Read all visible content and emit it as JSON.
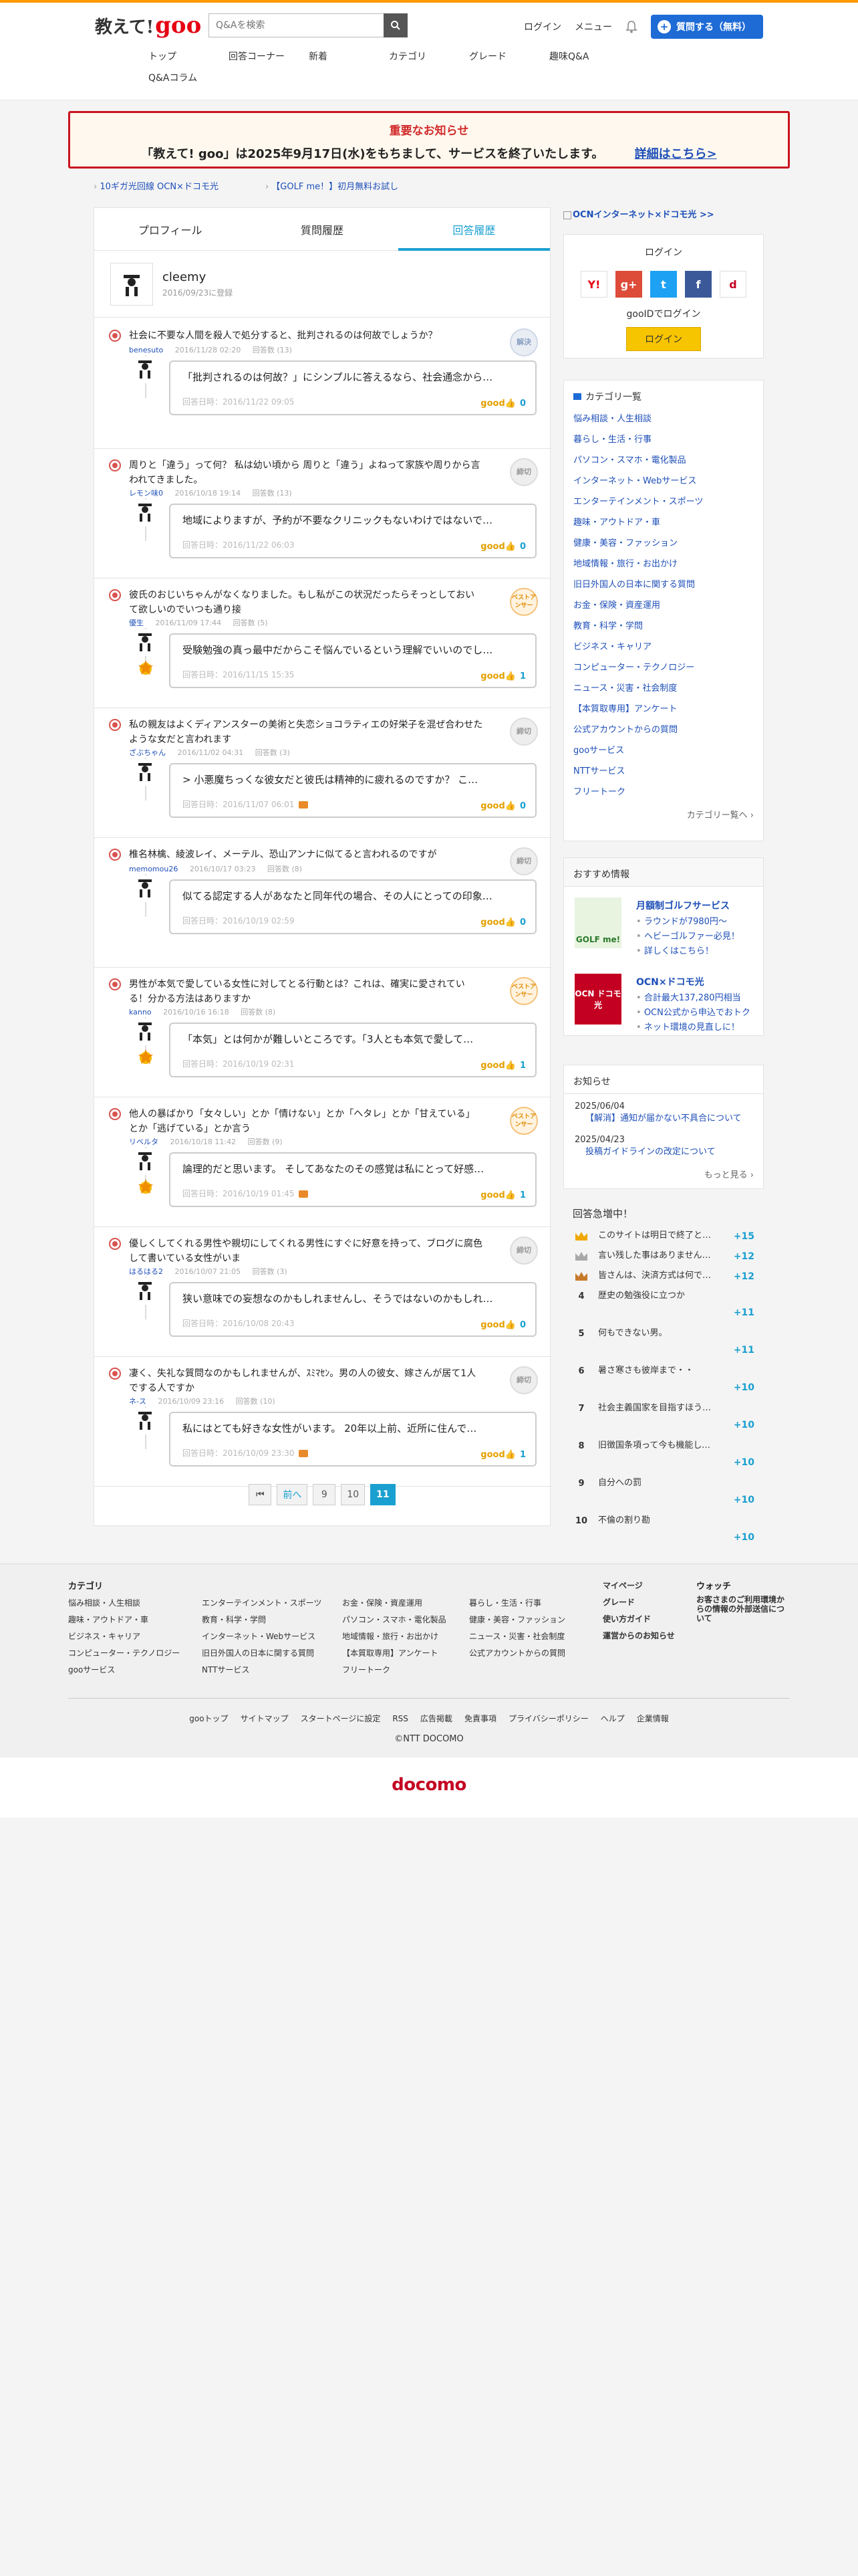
{
  "header": {
    "logo_prefix": "教えて!",
    "logo_goo": "goo",
    "search_placeholder": "Q&Aを検索",
    "login": "ログイン",
    "menu": "メニュー",
    "ask_button": "質問する（無料）",
    "nav": [
      "トップ",
      "回答コーナー",
      "新着",
      "カテゴリ",
      "グレード",
      "趣味Q&A",
      "Q&Aコラム"
    ]
  },
  "notice": {
    "title": "重要なお知らせ",
    "body": "「教えて! goo」は2025年9月17日(水)をもちまして、サービスを終了いたします。",
    "link": "詳細はこちら>"
  },
  "promos": [
    "10ギガ光回線 OCN×ドコモ光",
    "【GOLF me！】初月無料お試し"
  ],
  "tabs": [
    "プロフィール",
    "質問履歴",
    "回答履歴"
  ],
  "profile": {
    "name": "cleemy",
    "registered": "2016/09/23に登録"
  },
  "items": [
    {
      "q": "社会に不要な人間を殺人で処分すると、批判されるのは何故でしょうか？",
      "user": "benesuto",
      "date": "2016/11/28 02:20",
      "count": "回答数 (13)",
      "badge": "解決",
      "a": "「批判されるのは何故？」にシンプルに答えるなら、社会通念から…",
      "adate": "回答日時：2016/11/22 09:05",
      "good": "0",
      "photo": false
    },
    {
      "q": "周りと「違う」って何？ 私は幼い頃から 周りと「違う」よねって家族や周りから言われてきました。",
      "user": "レモン味0",
      "date": "2016/10/18 19:14",
      "count": "回答数 (13)",
      "badge": "締切",
      "a": "地域によりますが、予約が不要なクリニックもないわけではないで…",
      "adate": "回答日時：2016/11/22 06:03",
      "good": "0",
      "photo": false
    },
    {
      "q": "彼氏のおじいちゃんがなくなりました。もし私がこの状況だったらそっとしておいて欲しいのでいつも通り接",
      "user": "優生",
      "date": "2016/11/09 17:44",
      "count": "回答数 (5)",
      "badge": "ベストアンサー",
      "a": "受験勉強の真っ最中だからこそ悩んでいるという理解でいいのでし…",
      "adate": "回答日時：2016/11/15 15:35",
      "good": "1",
      "photo": false
    },
    {
      "q": "私の親友はよくディアンスターの美術と失恋ショコラティエの好栄子を混ぜ合わせたような女だと言われます",
      "user": "ざぶちゃん",
      "date": "2016/11/02 04:31",
      "count": "回答数 (3)",
      "badge": "締切",
      "a": "> 小悪魔ちっくな彼女だと彼氏は精神的に疲れるのですか？ こ…",
      "adate": "回答日時：2016/11/07 06:01",
      "good": "0",
      "photo": true
    },
    {
      "q": "椎名林檎、綾波レイ、メーテル、恐山アンナに似てると言われるのですが",
      "user": "memomou26",
      "date": "2016/10/17 03:23",
      "count": "回答数 (8)",
      "badge": "締切",
      "a": "似てる認定する人があなたと同年代の場合、その人にとっての印象…",
      "adate": "回答日時：2016/10/19 02:59",
      "good": "0",
      "photo": false
    },
    {
      "q": "男性が本気で愛している女性に対してとる行動とは？これは、確実に愛されている！分かる方法はありますか",
      "user": "kanno",
      "date": "2016/10/16 16:18",
      "count": "回答数 (8)",
      "badge": "ベストアンサー",
      "a": "「本気」とは何かが難しいところです。「3人とも本気で愛して…",
      "adate": "回答日時：2016/10/19 02:31",
      "good": "1",
      "photo": false
    },
    {
      "q": "他人の暴ばかり「女々しい」とか「情けない」とか「ヘタレ」とか「甘えている」とか「逃げている」とか言う",
      "user": "リベルタ",
      "date": "2016/10/18 11:42",
      "count": "回答数 (9)",
      "badge": "ベストアンサー",
      "a": "論理的だと思います。 そしてあなたのその感覚は私にとって好感…",
      "adate": "回答日時：2016/10/19 01:45",
      "good": "1",
      "photo": true
    },
    {
      "q": "優しくしてくれる男性や親切にしてくれる男性にすぐに好意を持って、ブログに腐色して書いている女性がいま",
      "user": "はるはる2",
      "date": "2016/10/07 21:05",
      "count": "回答数 (3)",
      "badge": "締切",
      "a": "狭い意味での妄想なのかもしれませんし、そうではないのかもしれ…",
      "adate": "回答日時：2016/10/08 20:43",
      "good": "0",
      "photo": false
    },
    {
      "q": "凄く、失礼な質問なのかもしれませんが、ｽﾐﾏｾﾝ。男の人の彼女、嫁さんが居て1人でする人ですか",
      "user": "ネ-ス",
      "date": "2016/10/09 23:16",
      "count": "回答数 (10)",
      "badge": "締切",
      "a": "私にはとても好きな女性がいます。 20年以上前、近所に住んで…",
      "adate": "回答日時：2016/10/09 23:30",
      "good": "1",
      "photo": true
    }
  ],
  "good_label": "good",
  "pager": {
    "first": "⏮",
    "prev": "前へ",
    "pages": [
      "9",
      "10",
      "11"
    ]
  },
  "side": {
    "banner": "OCNインターネット×ドコモ光 >>",
    "login_title": "ログイン",
    "goo_login_label": "gooIDでログイン",
    "goo_login_btn": "ログイン",
    "sns": [
      "Y!",
      "g+",
      "t",
      "f",
      "d"
    ],
    "cat_title": "カテゴリ一覧",
    "categories": [
      "悩み相談・人生相談",
      "暮らし・生活・行事",
      "パソコン・スマホ・電化製品",
      "インターネット・Webサービス",
      "エンターテインメント・スポーツ",
      "趣味・アウトドア・車",
      "健康・美容・ファッション",
      "地域情報・旅行・お出かけ",
      "旧日外国人の日本に関する質問",
      "お金・保険・資産運用",
      "教育・科学・学問",
      "ビジネス・キャリア",
      "コンピューター・テクノロジー",
      "ニュース・災害・社会制度",
      "【本質取専用】アンケート",
      "公式アカウントからの質問",
      "gooサービス",
      "NTTサービス",
      "フリートーク"
    ],
    "cat_more": "カテゴリー覧へ ›",
    "rec_title": "おすすめ情報",
    "recs": [
      {
        "title": "月額制ゴルフサービス",
        "items": [
          "ラウンドが7980円〜",
          "ヘビーゴルファー必見！",
          "詳しくはこちら！"
        ],
        "img": "GOLF me!"
      },
      {
        "title": "OCN×ドコモ光",
        "items": [
          "合計最大137,280円相当",
          "OCN公式から申込でおトク",
          "ネット環境の見直しに！"
        ],
        "img": "OCN ドコモ光"
      }
    ],
    "news_title": "お知らせ",
    "news": [
      {
        "date": "2025/06/04",
        "text": "【解消】通知が届かない不具合について"
      },
      {
        "date": "2025/04/23",
        "text": "投稿ガイドラインの改定について"
      }
    ],
    "news_more": "もっと見る ›",
    "rank_title": "回答急増中！",
    "ranks": [
      {
        "num": "",
        "title": "このサイトは明日で終了という…",
        "score": "+15"
      },
      {
        "num": "",
        "title": "言い残した事はありませんか？",
        "score": "+12"
      },
      {
        "num": "",
        "title": "皆さんは、決済方式は何でしょ…",
        "score": "+12"
      },
      {
        "num": "4",
        "title": "歴史の勉強役に立つか",
        "score": "+11"
      },
      {
        "num": "5",
        "title": "何もできない男。",
        "score": "+11"
      },
      {
        "num": "6",
        "title": "暑さ寒さも彼岸まで・・",
        "score": "+10"
      },
      {
        "num": "7",
        "title": "社会主義国家を目指すほうがい…",
        "score": "+10"
      },
      {
        "num": "8",
        "title": "旧徴国条項って今も機能してる…",
        "score": "+10"
      },
      {
        "num": "9",
        "title": "自分への罰",
        "score": "+10"
      },
      {
        "num": "10",
        "title": "不倫の割り勘",
        "score": "+10"
      }
    ]
  },
  "footer": {
    "cat_title": "カテゴリ",
    "col1": [
      "悩み相談・人生相談",
      "趣味・アウトドア・車",
      "ビジネス・キャリア",
      "コンピューター・テクノロジー",
      "gooサービス"
    ],
    "col2": [
      "エンターテインメント・スポーツ",
      "教育・科学・学問",
      "インターネット・Webサービス",
      "旧日外国人の日本に関する質問",
      "NTTサービス"
    ],
    "col3": [
      "お金・保険・資産運用",
      "パソコン・スマホ・電化製品",
      "地域情報・旅行・お出かけ",
      "【本質取専用】アンケート",
      "フリートーク"
    ],
    "col4": [
      "暮らし・生活・行事",
      "健康・美容・ファッション",
      "ニュース・災害・社会制度",
      "公式アカウントからの質問"
    ],
    "col5": [
      "マイページ",
      "グレード",
      "使い方ガイド",
      "運営からのお知らせ"
    ],
    "watch_title": "ウォッチ",
    "watch_text": "お客さまのご利用環境からの情報の外部送信について",
    "links": [
      "gooトップ",
      "サイトマップ",
      "スタートページに設定",
      "RSS",
      "広告掲載",
      "免責事項",
      "プライバシーポリシー",
      "ヘルプ",
      "企業情報"
    ],
    "copyright": "©NTT DOCOMO"
  },
  "brand": "docomo"
}
